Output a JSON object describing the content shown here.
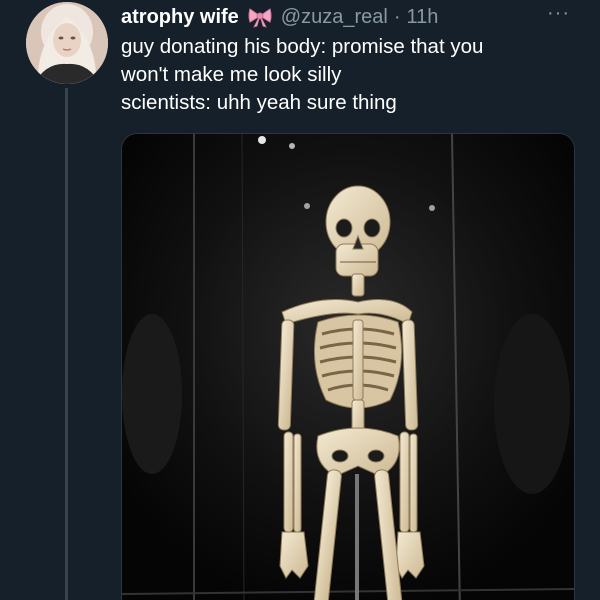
{
  "tweet": {
    "author_name": "atrophy wife",
    "author_emoji_icon": "ribbon-bow-icon",
    "handle": "@zuza_real",
    "separator": "·",
    "time": "11h",
    "more_label": "···",
    "text_lines": [
      "guy donating his body: promise that you",
      "won't make me look silly",
      "scientists: uhh yeah sure thing"
    ]
  },
  "colors": {
    "background": "#15202b",
    "text_primary": "#ffffff",
    "text_secondary": "#8899a6",
    "thread_line": "#38444d"
  },
  "media": {
    "subject_icon": "skeleton-display-photo"
  }
}
